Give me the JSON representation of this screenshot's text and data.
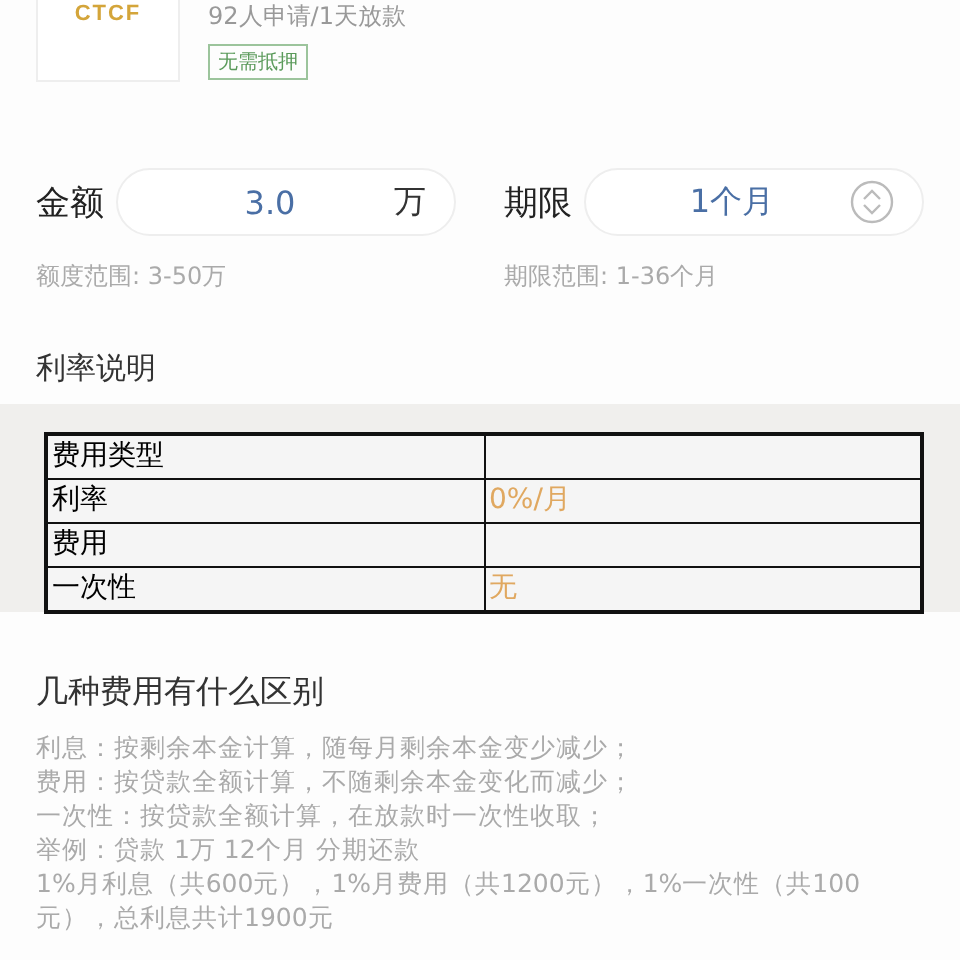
{
  "product": {
    "logo": "CTCF",
    "stats": "92人申请/1天放款",
    "tag": "无需抵押"
  },
  "amount": {
    "label": "金额",
    "value": "3.0",
    "unit": "万",
    "range": "额度范围: 3-50万"
  },
  "term": {
    "label": "期限",
    "value": "1个月",
    "range": "期限范围: 1-36个月"
  },
  "rate_title": "利率说明",
  "rate_table": [
    {
      "label": "费用类型"
    },
    {
      "label": "利率",
      "value": "0%/月"
    },
    {
      "label": "费用"
    },
    {
      "label": "一次性",
      "value": "无"
    }
  ],
  "diff_title": "几种费用有什么区别",
  "diff_lines": [
    "利息：按剩余本金计算，随每月剩余本金变少减少；",
    "费用：按贷款全额计算，不随剩余本金变化而减少；",
    "一次性：按贷款全额计算，在放款时一次性收取；",
    "举例：贷款 1万 12个月 分期还款",
    "1%月利息（共600元），1%月费用（共1200元），1%一次性（共100元），总利息共计1900元"
  ]
}
